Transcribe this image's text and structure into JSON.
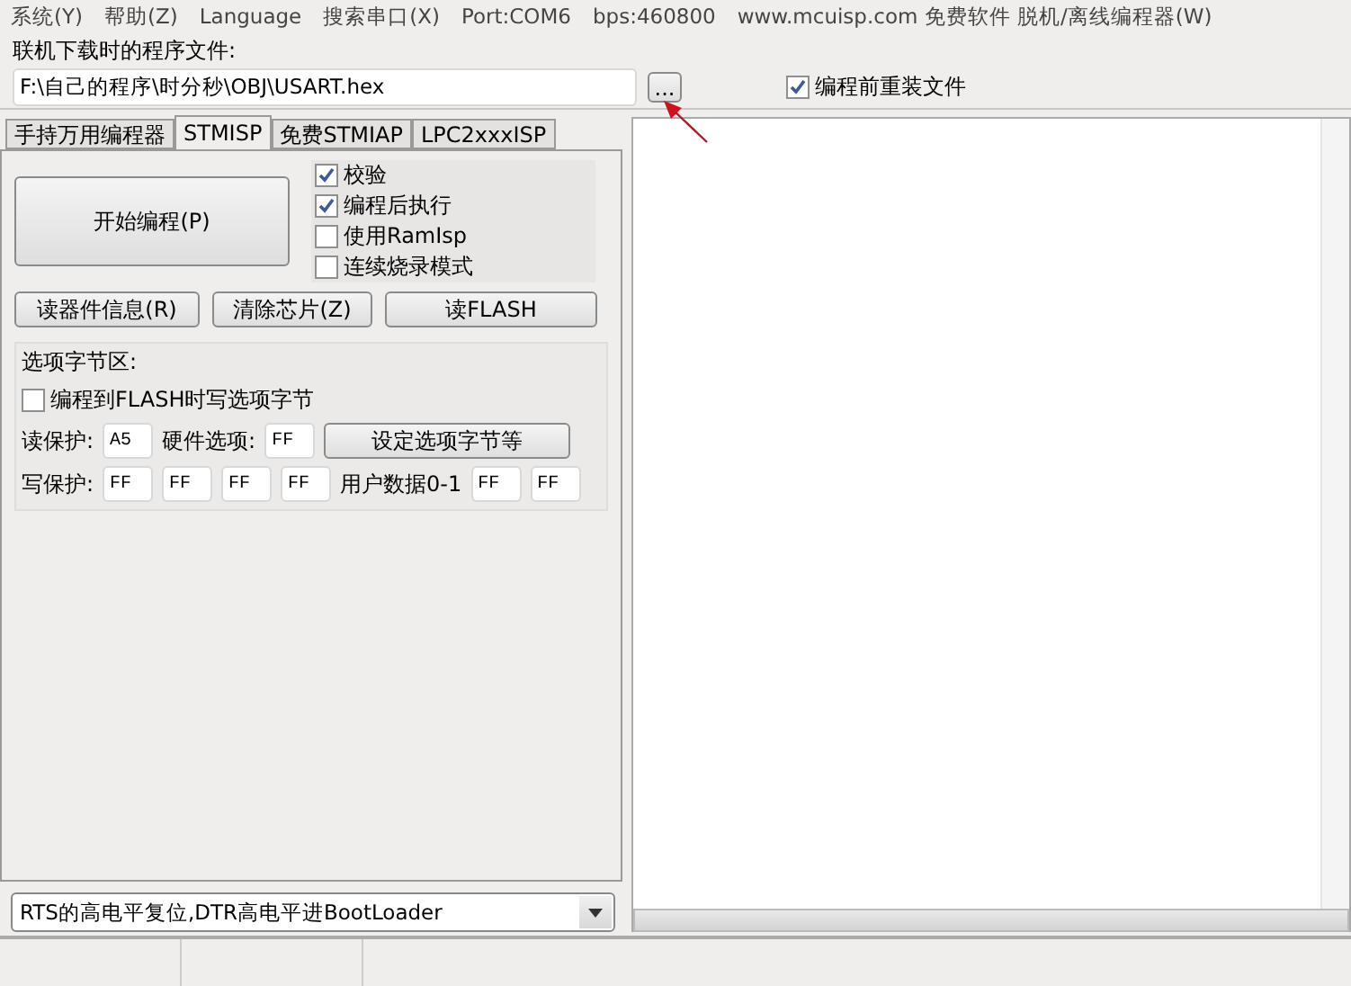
{
  "menu": [
    "系统(Y)",
    "帮助(Z)",
    "Language",
    "搜索串口(X)",
    "Port:COM6",
    "bps:460800",
    "www.mcuisp.com 免费软件 脱机/离线编程器(W)"
  ],
  "file": {
    "label": "联机下载时的程序文件:",
    "value": "F:\\自己的程序\\时分秒\\OBJ\\USART.hex",
    "browse": "...",
    "reload": {
      "label": "编程前重装文件",
      "checked": true
    }
  },
  "tabs": [
    {
      "label": "手持万用编程器",
      "selected": false
    },
    {
      "label": "STMISP",
      "selected": true
    },
    {
      "label": "免费STMIAP",
      "selected": false
    },
    {
      "label": "LPC2xxxISP",
      "selected": false
    }
  ],
  "start_button": "开始编程(P)",
  "options": [
    {
      "label": "校验",
      "checked": true
    },
    {
      "label": "编程后执行",
      "checked": true
    },
    {
      "label": "使用RamIsp",
      "checked": false
    },
    {
      "label": "连续烧录模式",
      "checked": false
    }
  ],
  "actions": [
    "读器件信息(R)",
    "清除芯片(Z)",
    "读FLASH"
  ],
  "option_bytes": {
    "title": "选项字节区:",
    "write_on_program": {
      "label": "编程到FLASH时写选项字节",
      "checked": false
    },
    "read_protect": {
      "label": "读保护:",
      "value": "A5"
    },
    "hardware": {
      "label": "硬件选项:",
      "value": "FF"
    },
    "set_button": "设定选项字节等",
    "write_protect": {
      "label": "写保护:",
      "values": [
        "FF",
        "FF",
        "FF",
        "FF"
      ]
    },
    "user_data": {
      "label": "用户数据0-1",
      "values": [
        "FF",
        "FF"
      ]
    }
  },
  "boot_mode": "RTS的高电平复位,DTR高电平进BootLoader"
}
